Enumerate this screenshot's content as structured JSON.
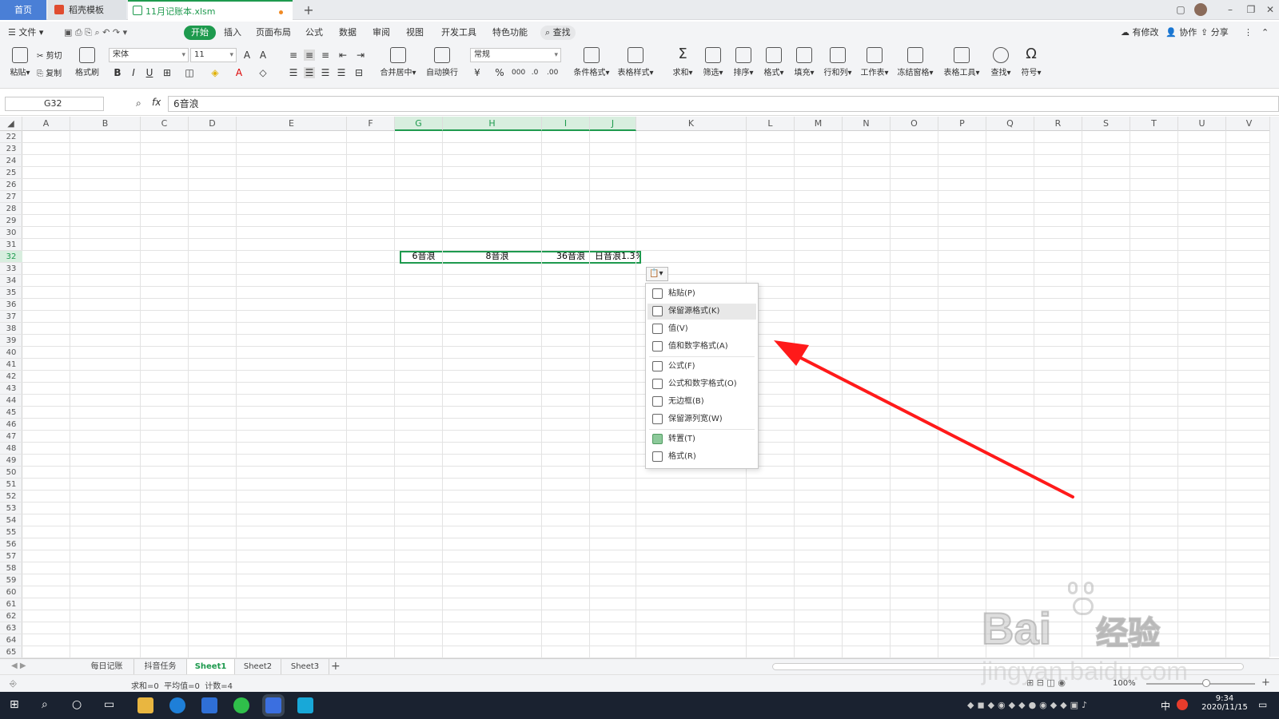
{
  "tabs": {
    "home": "首页",
    "template": "稻壳模板",
    "file": "11月记账本.xlsm"
  },
  "menu": {
    "file": "文件",
    "items": [
      "开始",
      "插入",
      "页面布局",
      "公式",
      "数据",
      "审阅",
      "视图",
      "开发工具",
      "特色功能"
    ],
    "search": "查找",
    "right": [
      "有修改",
      "协作",
      "分享"
    ]
  },
  "ribbon": {
    "paste": "粘贴",
    "cut": "剪切",
    "copy": "复制",
    "format_painter": "格式刷",
    "font_name": "宋体",
    "font_size": "11",
    "number_format": "常规",
    "merge": "合并居中",
    "wrap": "自动换行",
    "groups": [
      "条件格式",
      "表格样式",
      "求和",
      "筛选",
      "排序",
      "格式",
      "填充",
      "行和列",
      "工作表",
      "冻结窗格",
      "表格工具",
      "查找",
      "符号"
    ]
  },
  "formula": {
    "name_box": "G32",
    "fx": "fx",
    "content": "6音浪"
  },
  "columns": [
    "A",
    "B",
    "C",
    "D",
    "E",
    "F",
    "G",
    "H",
    "I",
    "J",
    "K",
    "L",
    "M",
    "N",
    "O",
    "P",
    "Q",
    "R",
    "S",
    "T",
    "U",
    "V"
  ],
  "selected_columns": [
    "G",
    "H",
    "I",
    "J"
  ],
  "rows": [
    "22",
    "23",
    "24",
    "25",
    "26",
    "27",
    "28",
    "29",
    "30",
    "31",
    "32",
    "33",
    "34",
    "35",
    "36",
    "37",
    "38",
    "39",
    "40",
    "41",
    "42",
    "43",
    "44",
    "45",
    "46",
    "47",
    "48",
    "49",
    "50",
    "51",
    "52",
    "53",
    "54",
    "55",
    "56",
    "57",
    "58",
    "59",
    "60",
    "61",
    "62",
    "63",
    "64",
    "65"
  ],
  "selected_row": "32",
  "cells": {
    "G32": "6音浪",
    "H32": "8音浪",
    "I32": "36音浪",
    "J32": "日音浪1.3%"
  },
  "paste_menu": {
    "items": [
      "粘贴(P)",
      "保留源格式(K)",
      "值(V)",
      "值和数字格式(A)",
      "公式(F)",
      "公式和数字格式(O)",
      "无边框(B)",
      "保留源列宽(W)",
      "转置(T)",
      "格式(R)"
    ],
    "highlighted": "保留源格式(K)"
  },
  "sheets": [
    "每日记账",
    "抖音任务",
    "Sheet1",
    "Sheet2",
    "Sheet3"
  ],
  "active_sheet": "Sheet1",
  "status": {
    "summary": "求和=0  平均值=0  计数=4",
    "zoom": "100%"
  },
  "taskbar": {
    "ime": "中",
    "time": "9:34",
    "date": "2020/11/15"
  },
  "watermark": {
    "brand": "Bai",
    "brand_cn": "经验",
    "url": "jingyan.baidu.com"
  },
  "colors": {
    "accent": "#1e9a4e",
    "arrow": "#ff1a1a",
    "home_tab": "#4a7fd6"
  }
}
